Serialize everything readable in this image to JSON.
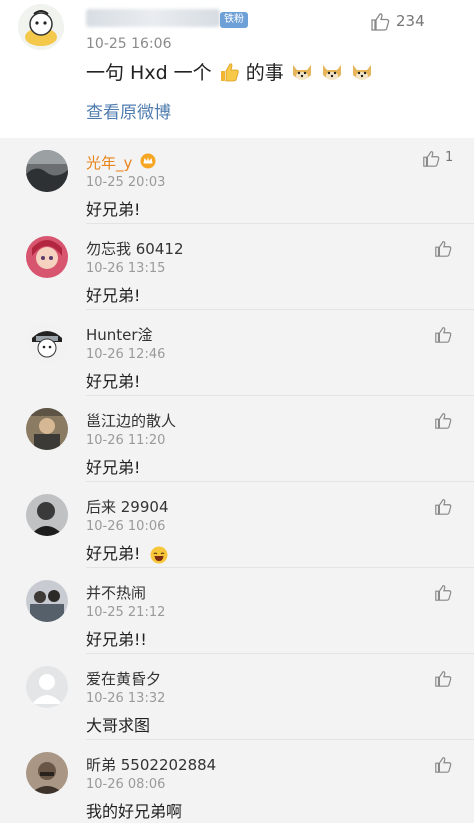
{
  "post": {
    "badge": "铁粉",
    "time": "10-25 16:06",
    "text_a": "一句 Hxd 一个",
    "text_b": "的事",
    "link": "查看原微博",
    "likes": "234"
  },
  "comments": [
    {
      "name": "光年_y",
      "time": "10-25 20:03",
      "text": "好兄弟!",
      "likes": "1"
    },
    {
      "name": "勿忘我 60412",
      "time": "10-26 13:15",
      "text": "好兄弟!"
    },
    {
      "name": "Hunter淦",
      "time": "10-26 12:46",
      "text": "好兄弟!"
    },
    {
      "name": "邕江边的散人",
      "time": "10-26 11:20",
      "text": "好兄弟!"
    },
    {
      "name": "后来 29904",
      "time": "10-26 10:06",
      "text": "好兄弟!"
    },
    {
      "name": "并不热闹",
      "time": "10-25 21:12",
      "text": "好兄弟!!"
    },
    {
      "name": "爱在黄昏夕",
      "time": "10-26 13:32",
      "text": "大哥求图"
    },
    {
      "name": "昕弟 5502202884",
      "time": "10-26 08:06",
      "text": "我的好兄弟啊"
    }
  ],
  "colors": {
    "link": "#4f7cae",
    "vip_name": "#e8841a",
    "badge": "#6ea0d8"
  }
}
